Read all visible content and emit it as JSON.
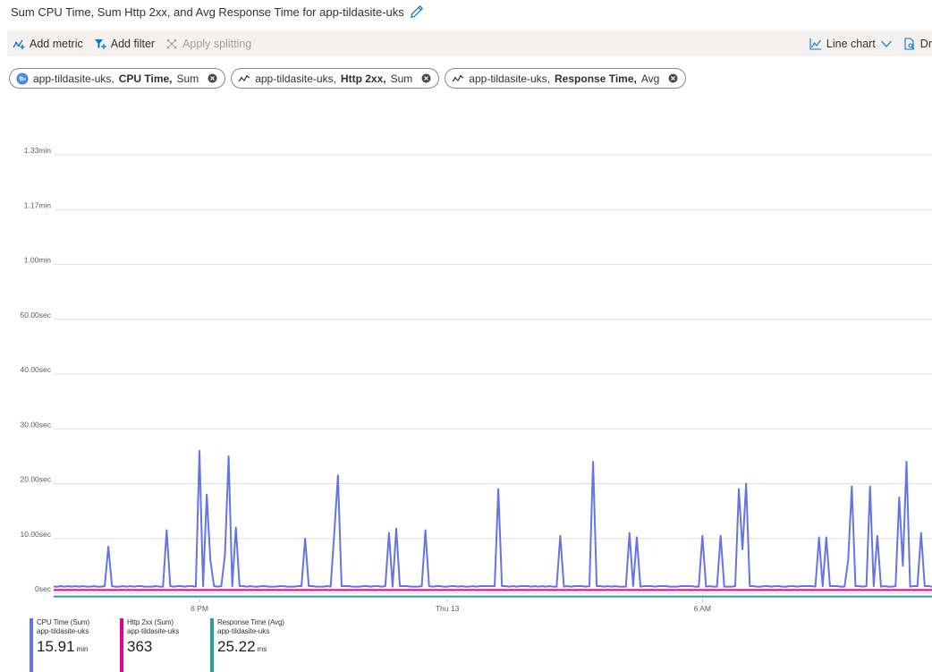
{
  "title": "Sum CPU Time, Sum Http 2xx, and Avg Response Time for app-tildasite-uks",
  "toolbar": {
    "add_metric": "Add metric",
    "add_filter": "Add filter",
    "apply_splitting": "Apply splitting",
    "line_chart": "Line chart",
    "drill": "Dr"
  },
  "pills": [
    {
      "resource": "app-tildasite-uks, ",
      "metric": "CPU Time,",
      "agg": " Sum"
    },
    {
      "resource": "app-tildasite-uks, ",
      "metric": "Http 2xx,",
      "agg": " Sum"
    },
    {
      "resource": "app-tildasite-uks, ",
      "metric": "Response Time,",
      "agg": " Avg"
    }
  ],
  "colors": {
    "cpu": "#6575e0",
    "http": "#e3008c",
    "response": "#2c9e9e",
    "grid": "#e1dfdd",
    "accent": "#0078d4"
  },
  "chart_data": {
    "type": "line",
    "y_tick_labels": [
      "0sec",
      "10.00sec",
      "20.00sec",
      "30.00sec",
      "40.00sec",
      "50.00sec",
      "1.00min",
      "1.17min",
      "1.33min"
    ],
    "y_tick_values_sec": [
      0,
      10,
      20,
      30,
      40,
      50,
      60,
      70,
      80
    ],
    "ylim_sec": [
      0,
      80
    ],
    "x_tick_labels": [
      "6 PM",
      "Thu 13",
      "6 AM"
    ],
    "x_tick_index": [
      40,
      108,
      178
    ],
    "grid": true,
    "series": [
      {
        "name": "CPU Time (Sum)",
        "values": [
          1.2,
          1.2,
          1.3,
          1.2,
          1.3,
          1.2,
          1.3,
          1.2,
          1.3,
          1.2,
          1.2,
          1.3,
          1.2,
          1.2,
          1.3,
          8.5,
          1.3,
          1.2,
          1.2,
          1.3,
          1.2,
          1.3,
          1.2,
          1.3,
          1.3,
          1.2,
          1.2,
          1.2,
          1.3,
          1.2,
          1.2,
          11.5,
          1.3,
          1.2,
          1.3,
          1.3,
          1.2,
          1.3,
          1.3,
          1.2,
          26,
          1.3,
          18,
          6,
          1.3,
          1.2,
          1.3,
          7,
          25,
          1.3,
          12,
          1.3,
          1.3,
          1.2,
          1.3,
          1.2,
          1.2,
          1.3,
          1.3,
          1.2,
          1.2,
          1.2,
          1.3,
          1.3,
          1.2,
          1.2,
          1.2,
          1.3,
          1.3,
          10,
          1.3,
          1.3,
          1.2,
          1.2,
          1.2,
          1.3,
          1.2,
          11,
          21.5,
          1.3,
          1.3,
          1.3,
          1.2,
          1.2,
          1.2,
          1.3,
          1.3,
          1.2,
          1.3,
          1.3,
          1.2,
          1.3,
          11,
          1.2,
          11.8,
          1.3,
          1.3,
          1.3,
          1.2,
          1.2,
          1.2,
          1.3,
          11.5,
          1.3,
          1.2,
          1.3,
          1.3,
          1.2,
          1.2,
          1.3,
          1.3,
          1.2,
          1.3,
          1.2,
          1.2,
          1.3,
          1.2,
          1.3,
          1.3,
          1.3,
          1.3,
          1.3,
          19,
          1.3,
          1.3,
          1.2,
          1.3,
          1.2,
          1.3,
          1.3,
          1.3,
          1.2,
          1.3,
          1.2,
          1.3,
          1.2,
          1.3,
          1.2,
          1.2,
          10.5,
          1.2,
          1.3,
          1.2,
          1.3,
          1.3,
          1.3,
          1.2,
          1.3,
          24,
          1.3,
          1.3,
          1.2,
          1.3,
          1.2,
          1.3,
          1.2,
          1.2,
          1.2,
          11,
          1.3,
          10.2,
          1.2,
          1.3,
          1.3,
          1.3,
          1.2,
          1.3,
          1.3,
          1.3,
          1.2,
          1.2,
          1.2,
          1.3,
          1.3,
          1.3,
          1.3,
          1.2,
          1.2,
          10.5,
          1.2,
          1.3,
          1.2,
          1.2,
          10.5,
          1.2,
          1.2,
          1.2,
          1.3,
          19,
          8,
          20,
          1.3,
          1.3,
          1.2,
          1.2,
          1.3,
          1.3,
          1.2,
          1.3,
          1.3,
          1.2,
          1.2,
          1.3,
          1.3,
          1.2,
          1.3,
          1.3,
          1.3,
          1.3,
          1.2,
          10.2,
          1.3,
          10.2,
          1.3,
          1.3,
          1.3,
          1.2,
          1.2,
          6,
          19.5,
          1.3,
          1.3,
          1.2,
          1.3,
          19.5,
          1.3,
          10.5,
          1.2,
          1.3,
          1.2,
          1.2,
          1.3,
          17.5,
          5,
          24,
          1.2,
          1.3,
          1.3,
          11,
          1.3,
          1.3,
          1.2
        ]
      },
      {
        "name": "Http 2xx (Sum)",
        "constant_sec_equivalent": 0.6,
        "values_count": 226
      },
      {
        "name": "Response Time (Avg)",
        "constant_sec_equivalent": -0.6,
        "values_count": 226
      }
    ]
  },
  "legend": [
    {
      "name": "CPU Time (Sum)",
      "resource": "app-tildasite-uks",
      "value": "15.91",
      "unit": "min"
    },
    {
      "name": "Http 2xx (Sum)",
      "resource": "app-tildasite-uks",
      "value": "363",
      "unit": ""
    },
    {
      "name": "Response Time (Avg)",
      "resource": "app-tildasite-uks",
      "value": "25.22",
      "unit": "ms"
    }
  ]
}
